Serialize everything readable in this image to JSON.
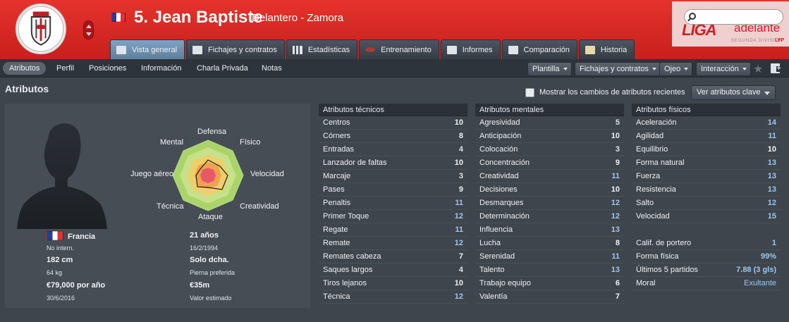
{
  "header": {
    "crest_text": "ZAMORA C.F.",
    "player_title": "5. Jean Baptiste",
    "position_club": "Delantero - Zamora",
    "sponsor": {
      "word1": "LIGA",
      "word2": "adelante",
      "division": "SEGUNDA DIVISIÓN",
      "lfp": "LFP"
    },
    "search_placeholder": ""
  },
  "tabs": [
    {
      "label": "Vista general",
      "icon": "overview-icon",
      "active": true
    },
    {
      "label": "Fichajes y contratos",
      "icon": "contract-icon"
    },
    {
      "label": "Estadísticas",
      "icon": "stats-icon"
    },
    {
      "label": "Entrenamiento",
      "icon": "training-icon"
    },
    {
      "label": "Informes",
      "icon": "report-icon"
    },
    {
      "label": "Comparación",
      "icon": "compare-icon"
    },
    {
      "label": "Historia",
      "icon": "history-icon"
    }
  ],
  "subnav": {
    "items": [
      "Atributos",
      "Perfil",
      "Posiciones",
      "Información",
      "Charla Privada",
      "Notas"
    ],
    "dropdowns": [
      "Plantilla",
      "Fichajes y contratos",
      "Ojeo",
      "Interacción"
    ]
  },
  "main": {
    "title": "Atributos",
    "checkbox_label": "Mostrar los cambios de atributos recientes",
    "key_button": "Ver atributos clave"
  },
  "radar_labels": [
    "Defensa",
    "Físico",
    "Velocidad",
    "Creatividad",
    "Ataque",
    "Técnica",
    "Juego aéreo",
    "Mental"
  ],
  "info": {
    "nationality": "Francia",
    "intl": "No intern.",
    "height": "182 cm",
    "weight": "64 kg",
    "wage": "€79,000 por año",
    "contract_end": "30/6/2016",
    "age": "21 años",
    "dob": "16/2/1994",
    "foot": "Solo dcha.",
    "foot_label": "Pierna preferida",
    "value": "€35m",
    "value_label": "Valor estimado"
  },
  "technical": {
    "title": "Atributos técnicos",
    "rows": [
      {
        "name": "Centros",
        "value": "10"
      },
      {
        "name": "Córners",
        "value": "8"
      },
      {
        "name": "Entradas",
        "value": "4"
      },
      {
        "name": "Lanzador de faltas",
        "value": "10"
      },
      {
        "name": "Marcaje",
        "value": "3"
      },
      {
        "name": "Pases",
        "value": "9"
      },
      {
        "name": "Penaltis",
        "value": "11"
      },
      {
        "name": "Primer Toque",
        "value": "12"
      },
      {
        "name": "Regate",
        "value": "11"
      },
      {
        "name": "Remate",
        "value": "12"
      },
      {
        "name": "Remates cabeza",
        "value": "7"
      },
      {
        "name": "Saques largos",
        "value": "4"
      },
      {
        "name": "Tiros lejanos",
        "value": "10"
      },
      {
        "name": "Técnica",
        "value": "12"
      }
    ]
  },
  "mental": {
    "title": "Atributos mentales",
    "rows": [
      {
        "name": "Agresividad",
        "value": "5"
      },
      {
        "name": "Anticipación",
        "value": "10"
      },
      {
        "name": "Colocación",
        "value": "3"
      },
      {
        "name": "Concentración",
        "value": "9"
      },
      {
        "name": "Creatividad",
        "value": "11"
      },
      {
        "name": "Decisiones",
        "value": "10"
      },
      {
        "name": "Desmarques",
        "value": "12"
      },
      {
        "name": "Determinación",
        "value": "12"
      },
      {
        "name": "Influencia",
        "value": "13"
      },
      {
        "name": "Lucha",
        "value": "8"
      },
      {
        "name": "Serenidad",
        "value": "11"
      },
      {
        "name": "Talento",
        "value": "13"
      },
      {
        "name": "Trabajo equipo",
        "value": "6"
      },
      {
        "name": "Valentía",
        "value": "7"
      }
    ]
  },
  "physical": {
    "title": "Atributos físicos",
    "rows": [
      {
        "name": "Aceleración",
        "value": "14"
      },
      {
        "name": "Agilidad",
        "value": "11"
      },
      {
        "name": "Equilibrio",
        "value": "10"
      },
      {
        "name": "Forma natural",
        "value": "13"
      },
      {
        "name": "Fuerza",
        "value": "13"
      },
      {
        "name": "Resistencia",
        "value": "13"
      },
      {
        "name": "Salto",
        "value": "12"
      },
      {
        "name": "Velocidad",
        "value": "15"
      }
    ],
    "extra": [
      {
        "name": "Calif. de portero",
        "value": "1"
      },
      {
        "name": "Forma física",
        "value": "99%"
      },
      {
        "name": "Últimos 5 partidos",
        "value": "7.88 (3 gls)"
      },
      {
        "name": "Moral",
        "value": "Exultante"
      }
    ]
  }
}
